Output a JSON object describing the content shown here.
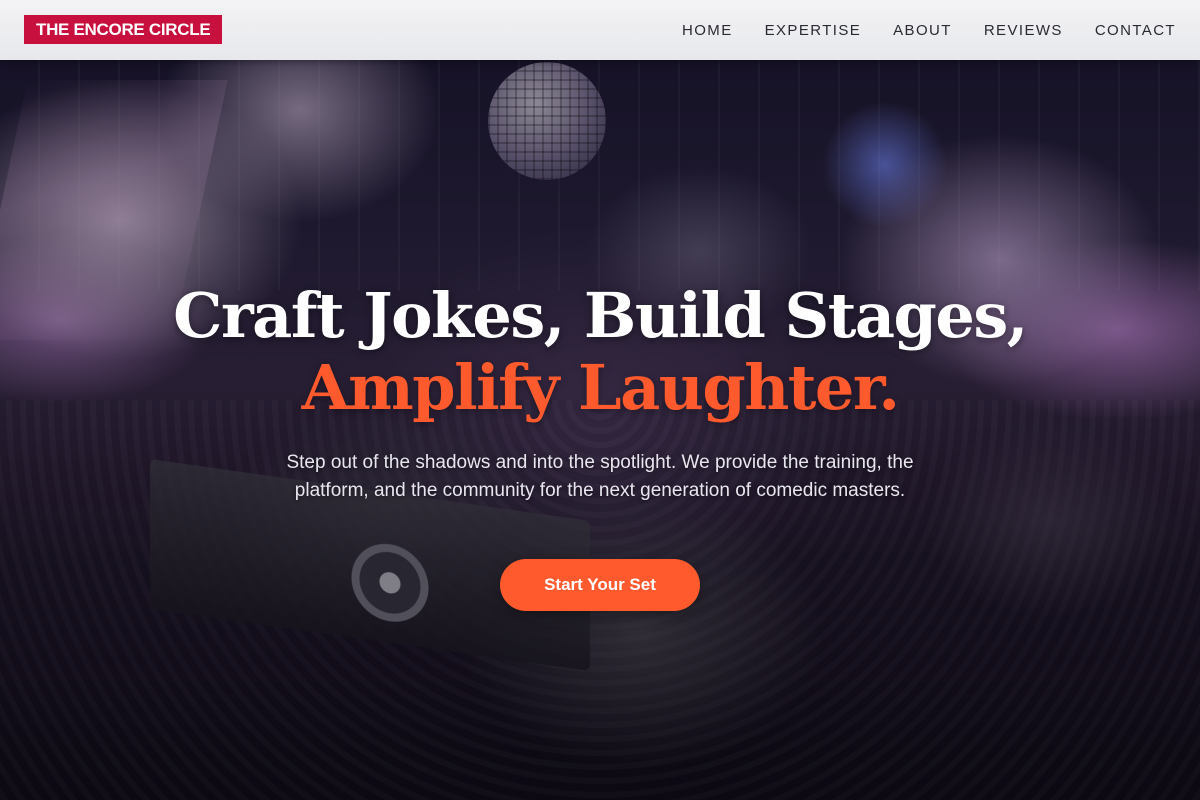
{
  "header": {
    "logo_text": "THE ENCORE CIRCLE",
    "nav": [
      {
        "label": "HOME"
      },
      {
        "label": "EXPERTISE"
      },
      {
        "label": "ABOUT"
      },
      {
        "label": "REVIEWS"
      },
      {
        "label": "CONTACT"
      }
    ]
  },
  "hero": {
    "headline_line1": "Craft Jokes, Build Stages,",
    "headline_line2": "Amplify Laughter.",
    "subtitle": "Step out of the shadows and into the spotlight. We provide the training, the platform, and the community for the next generation of comedic masters.",
    "cta_label": "Start Your Set"
  },
  "colors": {
    "brand": "#c8103e",
    "accent": "#ff5a2e",
    "header_bg": "#eeeef1",
    "nav_text": "#2a2a33"
  }
}
